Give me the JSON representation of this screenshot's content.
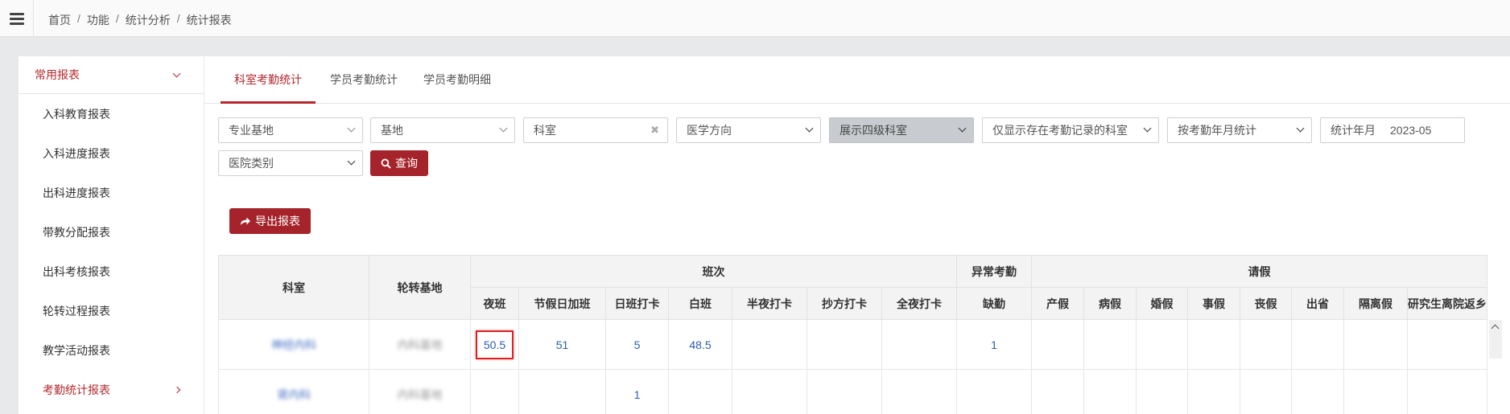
{
  "breadcrumb": [
    "首页",
    "功能",
    "统计分析",
    "统计报表"
  ],
  "sidebar": {
    "header": "常用报表",
    "items": [
      {
        "label": "入科教育报表"
      },
      {
        "label": "入科进度报表"
      },
      {
        "label": "出科进度报表"
      },
      {
        "label": "带教分配报表"
      },
      {
        "label": "出科考核报表"
      },
      {
        "label": "轮转过程报表"
      },
      {
        "label": "教学活动报表"
      },
      {
        "label": "考勤统计报表"
      }
    ]
  },
  "tabs": [
    {
      "label": "科室考勤统计"
    },
    {
      "label": "学员考勤统计"
    },
    {
      "label": "学员考勤明细"
    }
  ],
  "filters": {
    "major_base": "专业基地",
    "base": "基地",
    "dept_placeholder": "科室",
    "clear_icon": "✖",
    "medical_direction": "医学方向",
    "level4": "展示四级科室",
    "only_records": "仅显示存在考勤记录的科室",
    "stat_by": "按考勤年月统计",
    "stat_month_label": "统计年月",
    "stat_month_value": "2023-05",
    "hospital_type": "医院类别"
  },
  "buttons": {
    "query": "查询",
    "export": "导出报表"
  },
  "table": {
    "col_dept": "科室",
    "col_base": "轮转基地",
    "group_shift": "班次",
    "group_abnormal": "异常考勤",
    "group_leave": "请假",
    "shift_cols": [
      "夜班",
      "节假日加班",
      "日班打卡",
      "白班",
      "半夜打卡",
      "抄方打卡",
      "全夜打卡"
    ],
    "abnormal_cols": [
      "缺勤"
    ],
    "leave_cols": [
      "产假",
      "病假",
      "婚假",
      "事假",
      "丧假",
      "出省",
      "隔离假",
      "研究生离院返乡"
    ],
    "rows": [
      {
        "dept": "神经内科",
        "base": "内科基地",
        "cells": [
          "50.5",
          "51",
          "5",
          "48.5",
          "",
          "",
          "",
          "1",
          "",
          "",
          "",
          "",
          "",
          "",
          "",
          ""
        ]
      },
      {
        "dept": "肾内科",
        "base": "内科基地",
        "cells": [
          "",
          "",
          "1",
          "",
          "",
          "",
          "",
          "",
          "",
          "",
          "",
          "",
          "",
          "",
          "",
          ""
        ]
      }
    ]
  }
}
